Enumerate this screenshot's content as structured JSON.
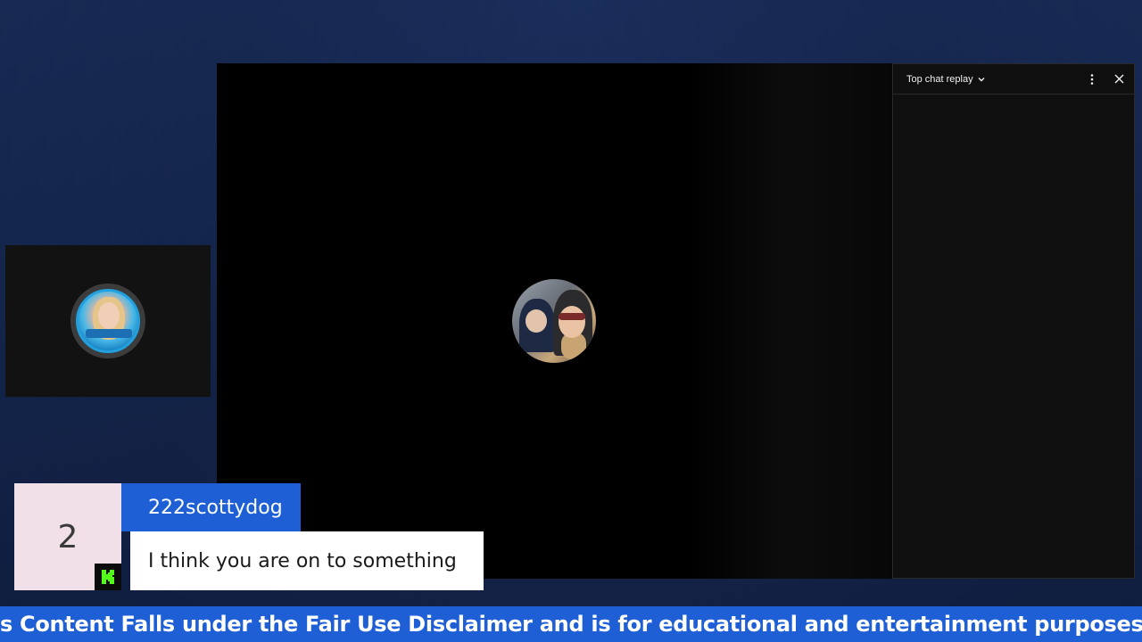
{
  "chat": {
    "title": "Top chat replay",
    "icons": [
      "chevron-down-icon",
      "more-vert-icon",
      "close-icon"
    ]
  },
  "alert": {
    "count": "2",
    "username": "222scottydog",
    "message": "I think you are on to something",
    "badge_icon": "kick-logo-icon"
  },
  "ticker": {
    "text": "s Content Falls under the Fair Use Disclaimer and is for educational and entertainment purposes only"
  },
  "colors": {
    "accent_blue": "#1e5fd6",
    "kick_green": "#53fc18",
    "background": "#142449"
  }
}
